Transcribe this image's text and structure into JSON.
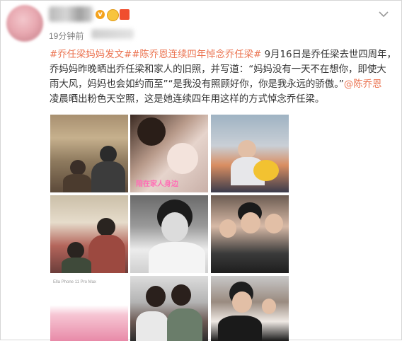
{
  "post": {
    "time": "19分钟前",
    "text": {
      "line1": {
        "tag1": "#乔任梁妈妈发文#",
        "tag2": "#陈乔恩连续四年悼念乔任梁#",
        "rest": " 9月16日是乔任梁去世四周年，"
      },
      "line2": "乔妈妈昨晚晒出乔任梁和家人的旧照，并写道：“妈妈没有一天不在想你，即使大",
      "line3": {
        "text": "雨大风，妈妈也会如约而至”“是我没有照顾好你，你是我永远的骄傲。”",
        "mention": "@陈乔恩"
      },
      "line4": "凌晨晒出粉色天空照，这是她连续四年用这样的方式悼念乔任梁。"
    },
    "photo_caption": "陪在家人身边",
    "photo7_text": "Ella Phone 11 Pro Max"
  },
  "icons": {
    "verified": "verified-badge-icon",
    "chevron": "chevron-down-icon"
  },
  "colors": {
    "link": "#eb7350",
    "text": "#333333",
    "meta": "#808080"
  }
}
